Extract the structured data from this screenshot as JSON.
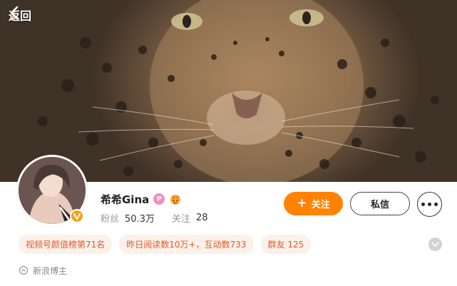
{
  "header": {
    "back_label": "返回"
  },
  "profile": {
    "name": "希希Gina",
    "badge_letter": "P",
    "stats": [
      {
        "label": "粉丝",
        "value": "50.3万"
      },
      {
        "label": "关注",
        "value": "28"
      }
    ],
    "actions": {
      "follow_label": "关注",
      "message_label": "私信"
    },
    "tags": [
      "视频号颜值榜第71名",
      "昨日阅读数10万+，互动数733",
      "群友 125"
    ],
    "footnote": "新浪博主"
  },
  "colors": {
    "accent": "#ff8200",
    "tag_bg": "#fcf0ea",
    "tag_text": "#e05a2a",
    "verified": "#f6a21a"
  },
  "icons": [
    "chevron-left-icon",
    "verified-icon",
    "member-icon",
    "crown-icon",
    "plus-icon",
    "more-icon",
    "chevron-down-icon",
    "blog-icon"
  ]
}
